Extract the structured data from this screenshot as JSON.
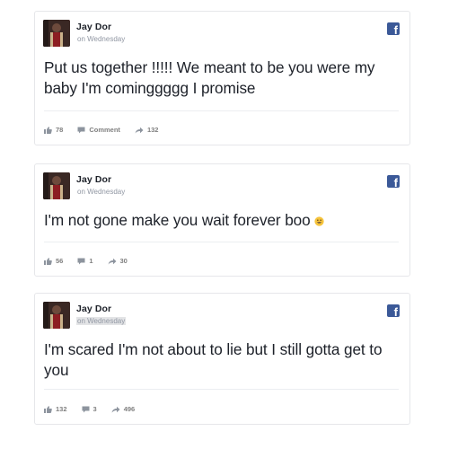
{
  "posts": [
    {
      "author": "Jay Dor",
      "timestamp": "on Wednesday",
      "text": "Put us together !!!!! We meant to be you were my baby I'm cominggggg I promise",
      "likes": "78",
      "comments": "Comment",
      "shares": "132"
    },
    {
      "author": "Jay Dor",
      "timestamp": "on Wednesday",
      "text": "I'm not gone make you wait forever boo",
      "emoji": "grinning-face-emoji",
      "likes": "56",
      "comments": "1",
      "shares": "30"
    },
    {
      "author": "Jay Dor",
      "timestamp": "on Wednesday",
      "text": "I'm scared I'm not about to lie but I still gotta get to you",
      "likes": "132",
      "comments": "3",
      "shares": "496"
    }
  ],
  "icons": {
    "brand": "facebook-icon",
    "like": "thumbs-up-icon",
    "comment": "comment-bubble-icon",
    "share": "share-arrow-icon"
  },
  "colors": {
    "facebook_blue": "#3b5998",
    "action_gray": "#7f7f7f",
    "timestamp_gray": "#9197a3",
    "text": "#1d2129"
  }
}
